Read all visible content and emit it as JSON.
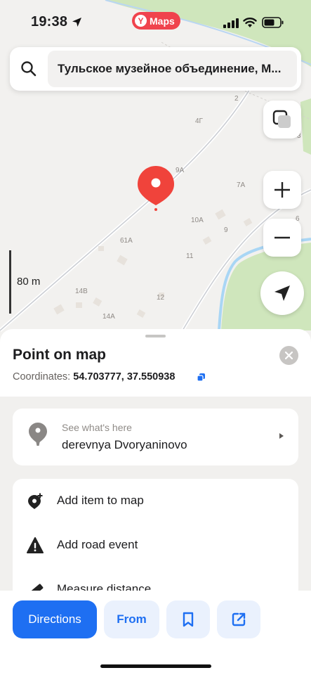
{
  "status_bar": {
    "time": "19:38",
    "app_badge": "Maps"
  },
  "search": {
    "value": "Тульское музейное объединение, М..."
  },
  "map": {
    "scale_label": "80 m",
    "house_numbers": [
      "2",
      "4Г",
      "3",
      "9А",
      "7А",
      "10А",
      "9",
      "6",
      "61А",
      "11",
      "14В",
      "12",
      "14А"
    ]
  },
  "sheet": {
    "title": "Point on map",
    "coordinates_label": "Coordinates:",
    "coordinates_value": "54.703777, 37.550938",
    "whats_here": {
      "label": "See what's here",
      "value": "derevnya Dvoryaninovo"
    },
    "actions": [
      {
        "label": "Add item to map",
        "icon": "pin-plus-icon"
      },
      {
        "label": "Add road event",
        "icon": "warning-icon"
      },
      {
        "label": "Measure distance",
        "icon": "ruler-icon"
      }
    ]
  },
  "bottom_bar": {
    "directions": "Directions",
    "from": "From"
  },
  "colors": {
    "accent": "#1e6ff2",
    "pin": "#f0433b",
    "park": "#cfe6bc",
    "water": "#a9d6f5"
  }
}
